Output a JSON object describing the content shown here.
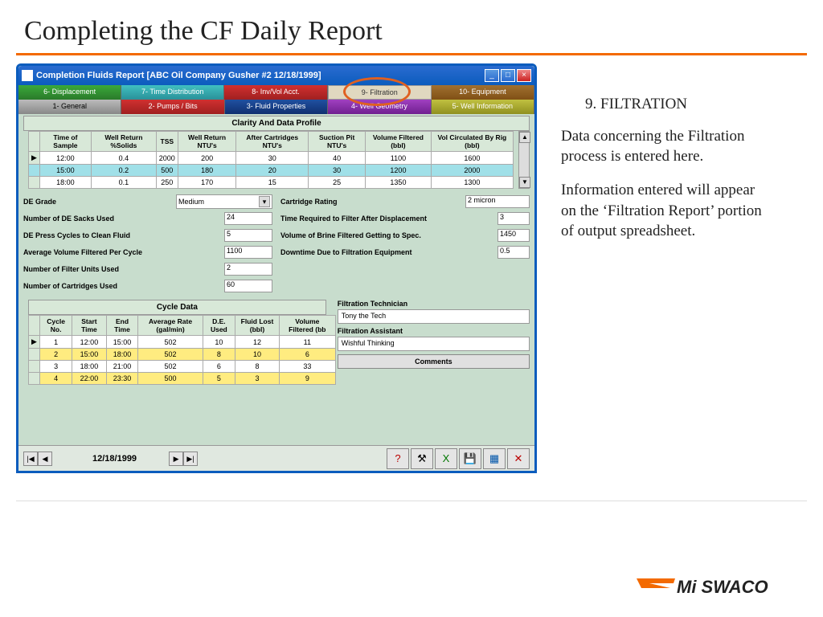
{
  "slide_title": "Completing the CF Daily Report",
  "window": {
    "title": "Completion Fluids Report [ABC Oil Company  Gusher #2  12/18/1999]",
    "min_icon": "_",
    "max_icon": "□",
    "close_icon": "×"
  },
  "tab_row_1": [
    "6- Displacement",
    "7- Time Distribution",
    "8- Inv/Vol Acct.",
    "9- Filtration",
    "10- Equipment"
  ],
  "tab_row_2": [
    "1- General",
    "2- Pumps / Bits",
    "3- Fluid Properties",
    "4- Well Geometry",
    "5- Well Information"
  ],
  "clarity": {
    "title": "Clarity And Data Profile",
    "headers": [
      "Time of Sample",
      "Well Return %Solids",
      "TSS",
      "Well Return NTU's",
      "After Cartridges NTU's",
      "Suction Pit NTU's",
      "Volume Filtered (bbl)",
      "Vol Circulated By Rig (bbl)"
    ],
    "rows": [
      [
        "12:00",
        "0.4",
        "2000",
        "200",
        "30",
        "40",
        "1100",
        "1600"
      ],
      [
        "15:00",
        "0.2",
        "500",
        "180",
        "20",
        "30",
        "1200",
        "2000"
      ],
      [
        "18:00",
        "0.1",
        "250",
        "170",
        "15",
        "25",
        "1350",
        "1300"
      ]
    ]
  },
  "params_left": [
    {
      "label": "DE Grade",
      "value": "Medium",
      "type": "select"
    },
    {
      "label": "Number of DE Sacks Used",
      "value": "24"
    },
    {
      "label": "DE Press Cycles to Clean Fluid",
      "value": "5"
    },
    {
      "label": "Average Volume Filtered Per Cycle",
      "value": "1100"
    },
    {
      "label": "Number of Filter Units Used",
      "value": "2"
    },
    {
      "label": "Number of Cartridges Used",
      "value": "60"
    }
  ],
  "params_right": [
    {
      "label": "Cartridge Rating",
      "value": "2 micron"
    },
    {
      "label": "Time Required to Filter After Displacement",
      "value": "3"
    },
    {
      "label": "Volume of Brine Filtered Getting to Spec.",
      "value": "1450"
    },
    {
      "label": "Downtime Due to Filtration Equipment",
      "value": "0.5"
    }
  ],
  "cycle": {
    "title": "Cycle Data",
    "headers": [
      "Cycle No.",
      "Start Time",
      "End Time",
      "Average Rate (gal/min)",
      "D.E. Used",
      "Fluid Lost (bbl)",
      "Volume Filtered (bb"
    ],
    "rows": [
      [
        "1",
        "12:00",
        "15:00",
        "502",
        "10",
        "12",
        "11"
      ],
      [
        "2",
        "15:00",
        "18:00",
        "502",
        "8",
        "10",
        "6"
      ],
      [
        "3",
        "18:00",
        "21:00",
        "502",
        "6",
        "8",
        "33"
      ],
      [
        "4",
        "22:00",
        "23:30",
        "500",
        "5",
        "3",
        "9"
      ]
    ]
  },
  "tech": {
    "label1": "Filtration Technician",
    "val1": "Tony the Tech",
    "label2": "Filtration Assistant",
    "val2": "Wishful Thinking",
    "comments": "Comments"
  },
  "bottom": {
    "date": "12/18/1999",
    "nav_first": "|◀",
    "nav_prev": "◀",
    "nav_next": "▶",
    "nav_last": "▶|"
  },
  "tools": [
    "?",
    "⚒",
    "X",
    "💾",
    "▦",
    "✕"
  ],
  "right_panel": {
    "heading": "9.  FILTRATION",
    "p1": "Data concerning the Filtration process  is entered here.",
    "p2": "Information entered will appear  on the ‘Filtration Report’ portion of output spreadsheet."
  }
}
